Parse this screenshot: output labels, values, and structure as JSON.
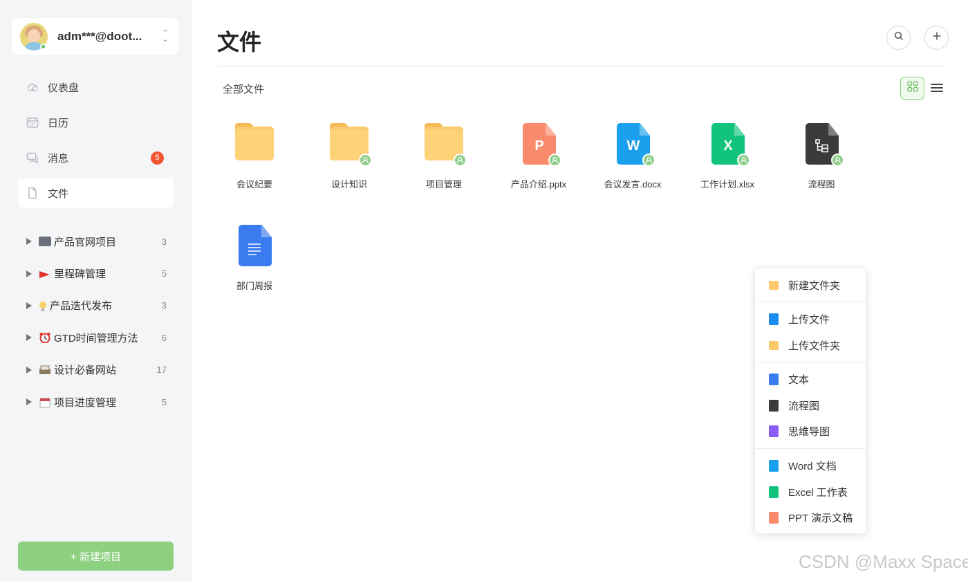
{
  "account": {
    "name": "adm***@doot..."
  },
  "nav": {
    "items": [
      {
        "label": "仪表盘",
        "icon": "dashboard-icon"
      },
      {
        "label": "日历",
        "icon": "calendar-icon"
      },
      {
        "label": "消息",
        "icon": "message-icon",
        "badge": "5"
      },
      {
        "label": "文件",
        "icon": "file-icon",
        "active": true
      }
    ]
  },
  "projects": [
    {
      "label": "产品官网项目",
      "count": "3",
      "emoji_color": "#6b6f7a"
    },
    {
      "label": "里程碑管理",
      "count": "5",
      "emoji_color": "#e0302a"
    },
    {
      "label": "产品迭代发布",
      "count": "3",
      "emoji_color": "#f7d267"
    },
    {
      "label": "GTD时间管理方法",
      "count": "6",
      "emoji_color": "#e0302a"
    },
    {
      "label": "设计必备网站",
      "count": "17",
      "emoji_color": "#8a7a5e"
    },
    {
      "label": "项目进度管理",
      "count": "5",
      "emoji_color": "#c94a4a"
    }
  ],
  "new_project_label": "+ 新建项目",
  "main": {
    "title": "文件",
    "breadcrumb": "全部文件"
  },
  "files": [
    {
      "name": "会议纪要",
      "type": "folder",
      "shared": false
    },
    {
      "name": "设计知识",
      "type": "folder",
      "shared": true
    },
    {
      "name": "项目管理",
      "type": "folder",
      "shared": true
    },
    {
      "name": "产品介绍.pptx",
      "type": "ppt",
      "letter": "P",
      "color": "#f98a6b",
      "shared": true
    },
    {
      "name": "会议发言.docx",
      "type": "word",
      "letter": "W",
      "color": "#1aa0ec",
      "shared": true
    },
    {
      "name": "工作计划.xlsx",
      "type": "excel",
      "letter": "X",
      "color": "#12c37e",
      "shared": true
    },
    {
      "name": "流程图",
      "type": "flowchart",
      "color": "#3b3b3b",
      "shared": true
    },
    {
      "name": "部门周报",
      "type": "doc",
      "color": "#3a7bf0",
      "shared": false
    }
  ],
  "create_menu": {
    "groups": [
      [
        {
          "label": "新建文件夹",
          "icon": "folder-icon",
          "color": "#fbc96a"
        }
      ],
      [
        {
          "label": "上传文件",
          "icon": "upload-file-icon",
          "color": "#1a8ef0"
        },
        {
          "label": "上传文件夹",
          "icon": "upload-folder-icon",
          "color": "#fbc96a"
        }
      ],
      [
        {
          "label": "文本",
          "icon": "text-doc-icon",
          "color": "#3a7bf0"
        },
        {
          "label": "流程图",
          "icon": "flowchart-icon",
          "color": "#3b3b3b"
        },
        {
          "label": "思维导图",
          "icon": "mindmap-icon",
          "color": "#8b5cf6"
        }
      ],
      [
        {
          "label": "Word 文档",
          "icon": "word-icon",
          "color": "#1aa0ec"
        },
        {
          "label": "Excel 工作表",
          "icon": "excel-icon",
          "color": "#12c37e"
        },
        {
          "label": "PPT 演示文稿",
          "icon": "ppt-icon",
          "color": "#f98a6b"
        }
      ]
    ]
  },
  "watermark": "CSDN @Maxx Space",
  "colors": {
    "accent": "#8dd07f",
    "badge": "#f25533",
    "sidebar_bg": "#f4f5f7"
  }
}
